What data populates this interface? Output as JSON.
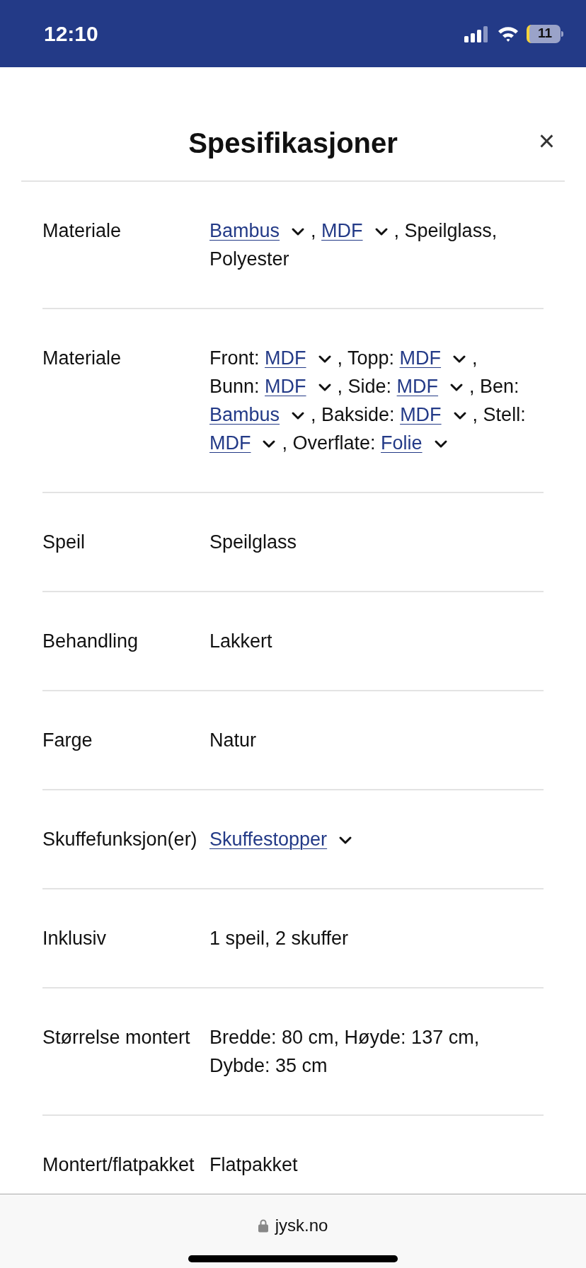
{
  "status_bar": {
    "time": "12:10",
    "battery": "11"
  },
  "dialog": {
    "title": "Spesifikasjoner",
    "close": "×"
  },
  "rows": [
    {
      "label": "Materiale",
      "value": [
        {
          "kind": "link",
          "text": "Bambus"
        },
        {
          "kind": "text",
          "text": ", "
        },
        {
          "kind": "link",
          "text": "MDF"
        },
        {
          "kind": "text",
          "text": ", Speilglass,"
        },
        {
          "kind": "text",
          "text": "Polyester"
        }
      ]
    },
    {
      "label": "Materiale",
      "value": [
        {
          "kind": "text",
          "text": "Front: "
        },
        {
          "kind": "link",
          "text": "MDF"
        },
        {
          "kind": "text",
          "text": ", Topp: "
        },
        {
          "kind": "link",
          "text": "MDF"
        },
        {
          "kind": "text",
          "text": ","
        },
        {
          "kind": "text",
          "text": "Bunn: "
        },
        {
          "kind": "link",
          "text": "MDF"
        },
        {
          "kind": "text",
          "text": ", Side: "
        },
        {
          "kind": "link",
          "text": "MDF"
        },
        {
          "kind": "text",
          "text": ", Ben: "
        },
        {
          "kind": "link",
          "text": "Bambus"
        },
        {
          "kind": "text",
          "text": ", Bakside: "
        },
        {
          "kind": "link",
          "text": "MDF"
        },
        {
          "kind": "text",
          "text": ", Stell: "
        },
        {
          "kind": "link",
          "text": "MDF"
        },
        {
          "kind": "text",
          "text": ", Overflate: "
        },
        {
          "kind": "link",
          "text": "Folie"
        }
      ]
    },
    {
      "label": "Speil",
      "value": [
        {
          "kind": "text",
          "text": "Speilglass"
        }
      ]
    },
    {
      "label": "Behandling",
      "value": [
        {
          "kind": "text",
          "text": "Lakkert"
        }
      ]
    },
    {
      "label": "Farge",
      "value": [
        {
          "kind": "text",
          "text": "Natur"
        }
      ]
    },
    {
      "label": "Skuffefunksjon(er)",
      "value": [
        {
          "kind": "link",
          "text": "Skuffestopper"
        }
      ]
    },
    {
      "label": "Inklusiv",
      "value": [
        {
          "kind": "text",
          "text": "1 speil, 2 skuffer"
        }
      ]
    },
    {
      "label": "Størrelse montert",
      "value": [
        {
          "kind": "text",
          "text": "Bredde: 80 cm, Høyde: 137 cm,"
        },
        {
          "kind": "text",
          "text": "Dybde: 35 cm"
        }
      ]
    },
    {
      "label": "Montert/flatpakket",
      "value": [
        {
          "kind": "text",
          "text": "Flatpakket"
        }
      ]
    }
  ],
  "browser_bar": {
    "url": "jysk.no"
  }
}
